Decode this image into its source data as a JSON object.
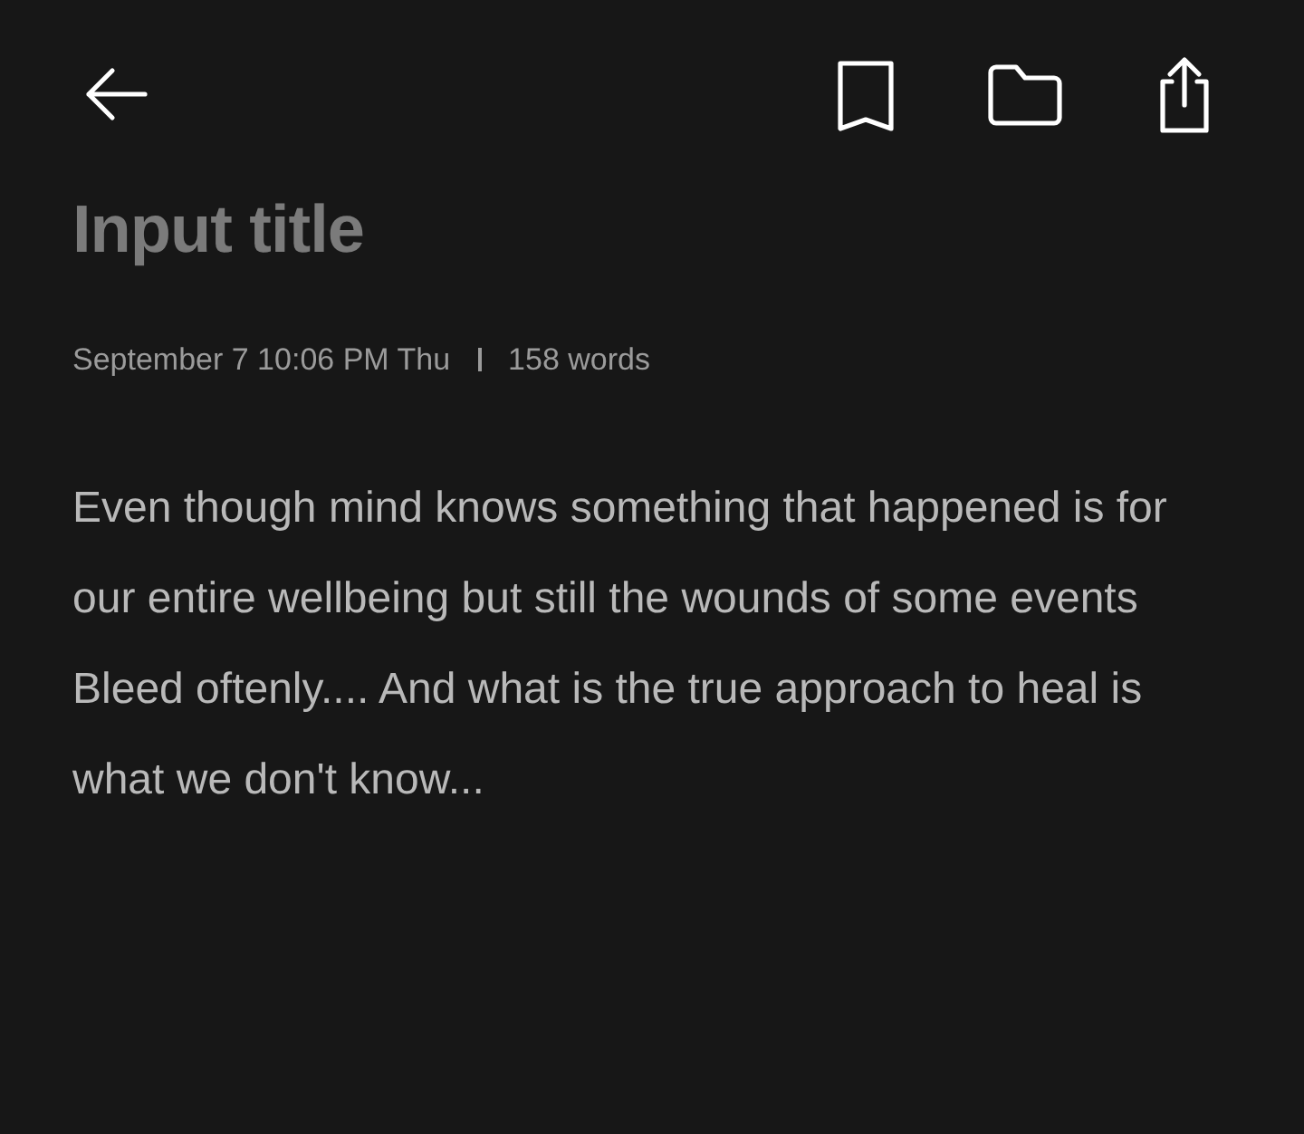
{
  "title_field": {
    "placeholder": "Input title"
  },
  "meta": {
    "date": "September 7 10:06 PM Thu",
    "word_count": "158 words"
  },
  "body": {
    "value": "Even though mind knows something that happened is for our entire wellbeing but still the wounds of some events Bleed oftenly.... And what is the true approach to heal is what we don't know..."
  }
}
